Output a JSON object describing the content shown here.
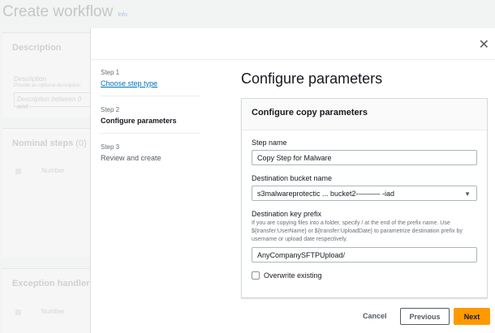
{
  "background": {
    "page_title": "Create workflow",
    "info": "Info",
    "description_header": "Description",
    "description_label": "Description",
    "description_hint": "Provide an optional description",
    "description_placeholder": "Description between 0 and",
    "nominal_header": "Nominal steps",
    "nominal_count": "(0)",
    "number_col": "Number",
    "exception_header": "Exception handlers",
    "exception_number_col": "Number"
  },
  "modal": {
    "steps": [
      {
        "label": "Step 1",
        "name": "Choose step type"
      },
      {
        "label": "Step 2",
        "name": "Configure parameters"
      },
      {
        "label": "Step 3",
        "name": "Review and create"
      }
    ],
    "title": "Configure parameters",
    "panel_title": "Configure copy parameters",
    "step_name_label": "Step name",
    "step_name_value": "Copy Step for Malware",
    "bucket_label": "Destination bucket name",
    "bucket_value": "s3malwareprotectic ... bucket2-——— -iad",
    "prefix_label": "Destination key prefix",
    "prefix_desc": "If you are copying files into a folder, specify / at the end of the prefix name. Use ${transfer:UserName} or ${transfer:UploadDate} to parametrize destination prefix by username or upload date respectively.",
    "prefix_value": "AnyCompanySFTPUpload/",
    "overwrite_label": "Overwrite existing",
    "cancel": "Cancel",
    "previous": "Previous",
    "next": "Next",
    "close": "✕"
  }
}
